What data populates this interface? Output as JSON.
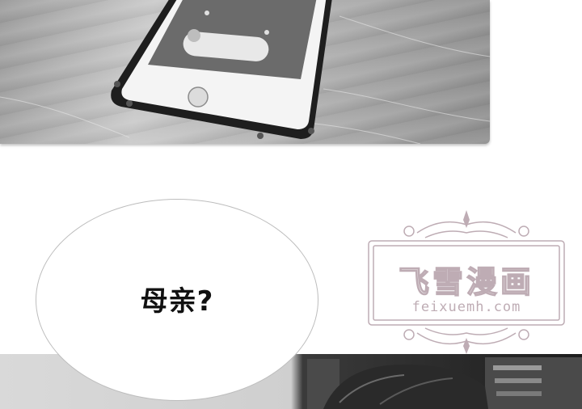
{
  "speech_bubble": {
    "text": "母亲?"
  },
  "watermark": {
    "title": "飞雪漫画",
    "url": "feixuemh.com"
  },
  "colors": {
    "watermark": "#8a6a78",
    "bubble_border": "#bdbdbd",
    "page_background": "#ffffff"
  },
  "panels": [
    {
      "name": "phone-on-table-photo"
    },
    {
      "name": "person-with-shelves-photo"
    }
  ]
}
